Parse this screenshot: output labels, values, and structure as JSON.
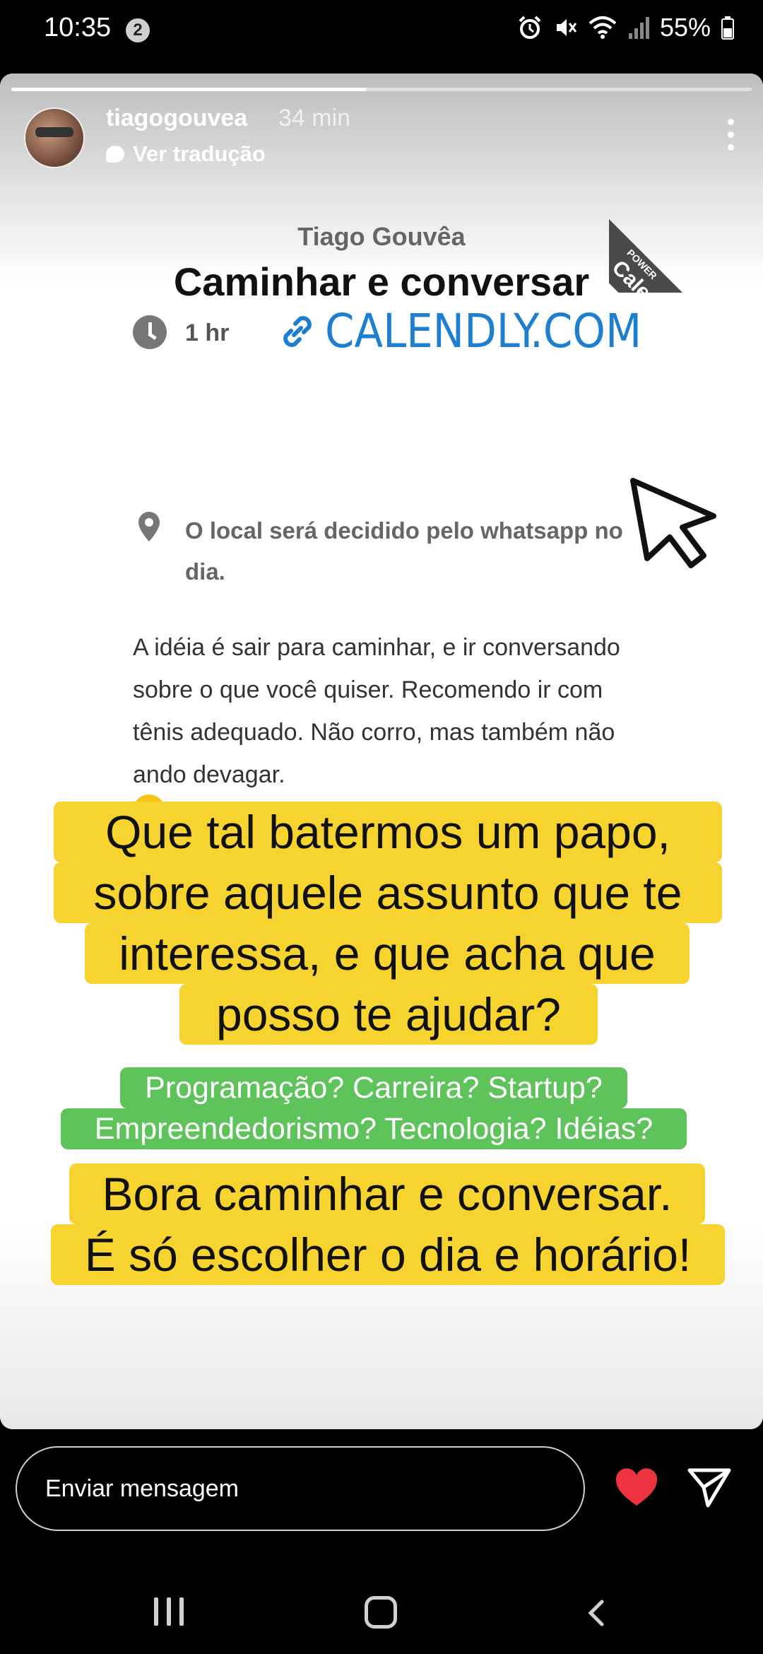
{
  "status_bar": {
    "time": "10:35",
    "notification_count": "2",
    "battery": "55%"
  },
  "story": {
    "progress": 0.48,
    "username": "tiagogouvea",
    "time_ago": "34 min",
    "translate_label": "Ver tradução",
    "calendly": {
      "ribbon_text": "Calen",
      "ribbon_small": "POWER",
      "owner": "Tiago Gouvêa",
      "title": "Caminhar e conversar",
      "duration": "1 hr",
      "link_text": "CALENDLY.COM",
      "location": "O local será decidido pelo whatsapp no dia.",
      "description": "A idéia é sair para caminhar, e ir conversando sobre o que você quiser. Recomendo ir com tênis adequado. Não corro, mas também não ando devagar."
    },
    "caption": {
      "yellow_lines_1": [
        "Que tal batermos um papo,",
        "sobre aquele assunto que te",
        "interessa, e que acha que",
        "posso te ajudar?"
      ],
      "green_lines": [
        "Programação? Carreira? Startup?",
        "Empreendedorismo? Tecnologia? Idéias?"
      ],
      "yellow_lines_2": [
        "Bora caminhar e conversar.",
        "É só escolher o dia e horário!"
      ]
    }
  },
  "message_bar": {
    "placeholder": "Enviar mensagem"
  },
  "colors": {
    "caption_yellow": "#f7d32f",
    "caption_green": "#5fc35b",
    "link_blue": "#1e7fd1",
    "heart_red": "#ed3340"
  },
  "icons": [
    "alarm-icon",
    "mute-icon",
    "wifi-icon",
    "signal-icon",
    "battery-icon",
    "clock-icon",
    "link-icon",
    "location-pin-icon",
    "cursor-icon",
    "sunglasses-emoji",
    "heart-icon",
    "send-icon",
    "more-options-icon"
  ]
}
